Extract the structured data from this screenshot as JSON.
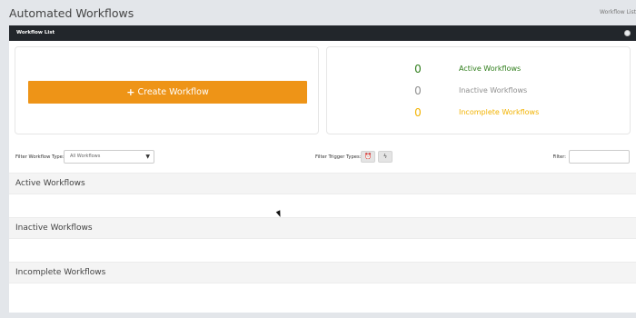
{
  "page": {
    "title": "Automated Workflows",
    "breadcrumb": "Workflow List"
  },
  "panel": {
    "header_title": "Workflow List"
  },
  "create_button": {
    "icon": "plus-icon",
    "label": "Create Workflow"
  },
  "stats": [
    {
      "count": "0",
      "label": "Active Workflows",
      "color": "#2e7d1a"
    },
    {
      "count": "0",
      "label": "Inactive Workflows",
      "color": "#8f8f8f"
    },
    {
      "count": "0",
      "label": "Incomplete Workflows",
      "color": "#f2b200"
    }
  ],
  "filters": {
    "workflow_type_label": "Filter Workflow Type:",
    "workflow_type_value": "All Workflows",
    "trigger_types_label": "Filter Trigger Types:",
    "trigger_buttons": [
      "clock-icon",
      "lightning-icon"
    ],
    "text_filter_label": "Filter:",
    "text_filter_value": ""
  },
  "sections": [
    {
      "title": "Active Workflows"
    },
    {
      "title": "Inactive Workflows"
    },
    {
      "title": "Incomplete Workflows"
    }
  ],
  "colors": {
    "accent": "#ee9417",
    "header_bg": "#22262b",
    "page_bg": "#e3e6ea"
  }
}
